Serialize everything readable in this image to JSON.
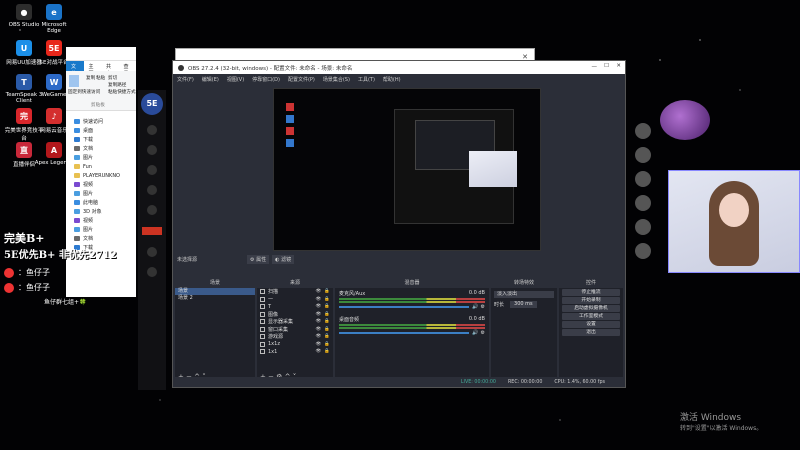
{
  "desktop": {
    "icons": [
      {
        "label": "OBS Studio",
        "color": "#2d2d2d",
        "glyph": "●"
      },
      {
        "label": "Microsoft Edge",
        "color": "#1a73c8",
        "glyph": "e"
      },
      {
        "label": "网易UU加速器",
        "color": "#1b8fe8",
        "glyph": "U"
      },
      {
        "label": "5E对战平台",
        "color": "#e8271b",
        "glyph": "5E"
      },
      {
        "label": "TeamSpeak 3 Client",
        "color": "#2a5aa8",
        "glyph": "T"
      },
      {
        "label": "WeGame",
        "color": "#2d6ac8",
        "glyph": "W"
      },
      {
        "label": "完美世界竞技平台",
        "color": "#d8262b",
        "glyph": "完"
      },
      {
        "label": "网易云音乐",
        "color": "#d42e2e",
        "glyph": "♪"
      },
      {
        "label": "直播伴侣",
        "color": "#c8283a",
        "glyph": "直"
      },
      {
        "label": "Apex Legends",
        "color": "#b3181c",
        "glyph": "A"
      }
    ]
  },
  "explorer": {
    "tabs": [
      "文件",
      "主页",
      "共享",
      "查看"
    ],
    "ribbon": {
      "pin": "固定到快速访问",
      "copy": "复制",
      "paste": "粘贴",
      "cut": "剪切",
      "copy_path": "复制路径",
      "paste_shortcut": "粘贴快捷方式",
      "clipboard": "剪贴板"
    },
    "quick_access": "快速访问",
    "items": [
      "桌面",
      "下载",
      "文档",
      "图片",
      "Fun",
      "PLAYERUNKNO",
      "视频",
      "图片",
      "此电脑",
      "3D 对象",
      "视频",
      "图片",
      "文档",
      "下载"
    ]
  },
  "obs": {
    "back_title": "",
    "title": "OBS 27.2.4 (32-bit, windows) - 配置文件: 未命名 - 场景: 未命名",
    "menu": [
      "文件(F)",
      "编辑(E)",
      "视图(V)",
      "停靠窗口(D)",
      "配置文件(P)",
      "场景集合(S)",
      "工具(T)",
      "帮助(H)"
    ],
    "no_source": "未选择源",
    "props_btn": "属性",
    "filters_btn": "滤镜",
    "docks": {
      "scenes": "场景",
      "sources": "来源",
      "mixer": "混音器",
      "transitions": "转场特效",
      "controls": "控件"
    },
    "scenes": [
      "场景",
      "场景 2"
    ],
    "sources": [
      "扫描",
      "一",
      "T",
      "图像",
      "显示器采集",
      "窗口采集",
      "游戏源",
      "1x1z",
      "1x1"
    ],
    "mixer": [
      {
        "name": "麦克风/Aux",
        "db": "0.0 dB"
      },
      {
        "name": "桌面音频",
        "db": "0.0 dB"
      }
    ],
    "transitions": {
      "type": "淡入淡出",
      "duration_label": "时长",
      "duration": "300 ms"
    },
    "controls": [
      "停止推流",
      "开始录制",
      "启动虚拟摄像机",
      "工作室模式",
      "设置",
      "退出"
    ],
    "status": {
      "live": "LIVE: 00:00:00",
      "rec": "REC: 00:00:00",
      "cpu": "CPU: 1.4%, 60.00 fps"
    }
  },
  "overlay": {
    "line1": "完美B+",
    "line2": "5E优先B+  非优先2712",
    "weibo": "：鱼仔子",
    "douyu": "：鱼仔子",
    "footer": "鱼仔群七组+🍀"
  },
  "activate": {
    "title": "激活 Windows",
    "sub": "转到\"设置\"以激活 Windows。"
  }
}
